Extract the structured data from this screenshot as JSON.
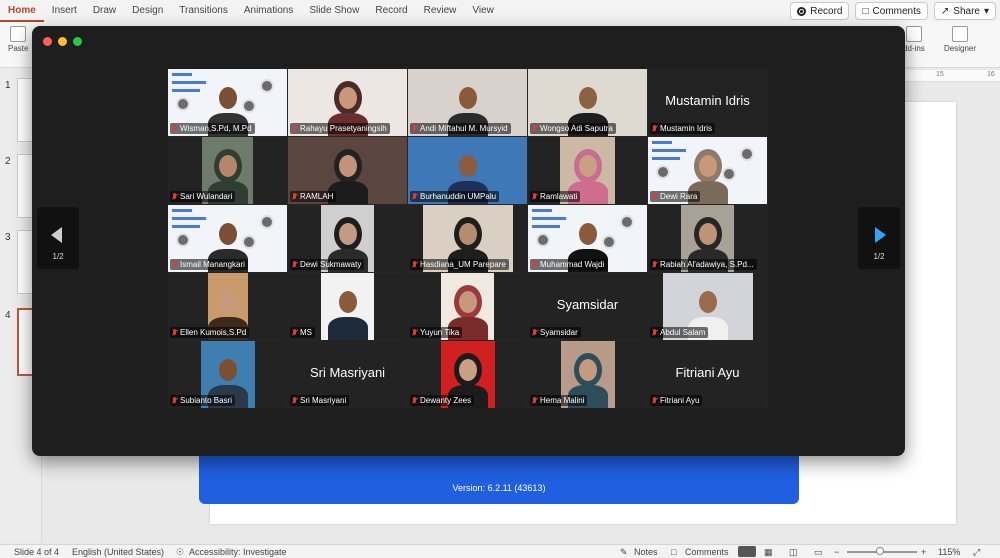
{
  "ribbon": {
    "tabs": [
      "Home",
      "Insert",
      "Draw",
      "Design",
      "Transitions",
      "Animations",
      "Slide Show",
      "Record",
      "Review",
      "View"
    ],
    "record_label": "Record",
    "comments_label": "Comments",
    "share_label": "Share",
    "paste_label": "Paste",
    "addins_label": "dd-ins",
    "designer_label": "Designer"
  },
  "ruler": {
    "t15": "15",
    "t16": "16"
  },
  "thumbnails": [
    "1",
    "2",
    "3",
    "4"
  ],
  "banner": {
    "version": "Version: 6.2.11 (43613)"
  },
  "status": {
    "slide": "Slide 4 of 4",
    "language": "English (United States)",
    "accessibility": "Accessibility: Investigate",
    "notes": "Notes",
    "comments": "Comments",
    "zoom": "115%"
  },
  "zoom_meeting": {
    "page_left": "1/2",
    "page_right": "1/2",
    "participants": [
      {
        "name": "Wisman,S.Pd, M.Pd",
        "big": ""
      },
      {
        "name": "Rahayu Prasetyaningsih",
        "big": ""
      },
      {
        "name": "Andi Miftahul M. Mursyid",
        "big": ""
      },
      {
        "name": "Wongso Adi Saputra",
        "big": ""
      },
      {
        "name": "Mustamin Idris",
        "big": "Mustamin Idris"
      },
      {
        "name": "Sari Wulandari",
        "big": ""
      },
      {
        "name": "RAMLAH",
        "big": ""
      },
      {
        "name": "Burhanuddin UMPalu",
        "big": ""
      },
      {
        "name": "Ramlawati",
        "big": ""
      },
      {
        "name": "Dewi Rara",
        "big": ""
      },
      {
        "name": "Ismail Manangkari",
        "big": ""
      },
      {
        "name": "Dewi Sukmawaty",
        "big": ""
      },
      {
        "name": "Hasdiana_UM Parepare",
        "big": ""
      },
      {
        "name": "Muhammad Wajdi",
        "big": ""
      },
      {
        "name": "Rabiah Al'adawiya, S.Pd...",
        "big": ""
      },
      {
        "name": "Ellen Kumois,S.Pd",
        "big": ""
      },
      {
        "name": "MS",
        "big": ""
      },
      {
        "name": "Yuyun Tika",
        "big": ""
      },
      {
        "name": "Syamsidar",
        "big": "Syamsidar"
      },
      {
        "name": "Abdul Salam",
        "big": ""
      },
      {
        "name": "Subianto Basri",
        "big": ""
      },
      {
        "name": "Sri Masriyani",
        "big": "Sri Masriyani"
      },
      {
        "name": "Dewanty Zees",
        "big": ""
      },
      {
        "name": "Hema Malini",
        "big": ""
      },
      {
        "name": "Fitriani Ayu",
        "big": "Fitriani Ayu"
      }
    ]
  }
}
